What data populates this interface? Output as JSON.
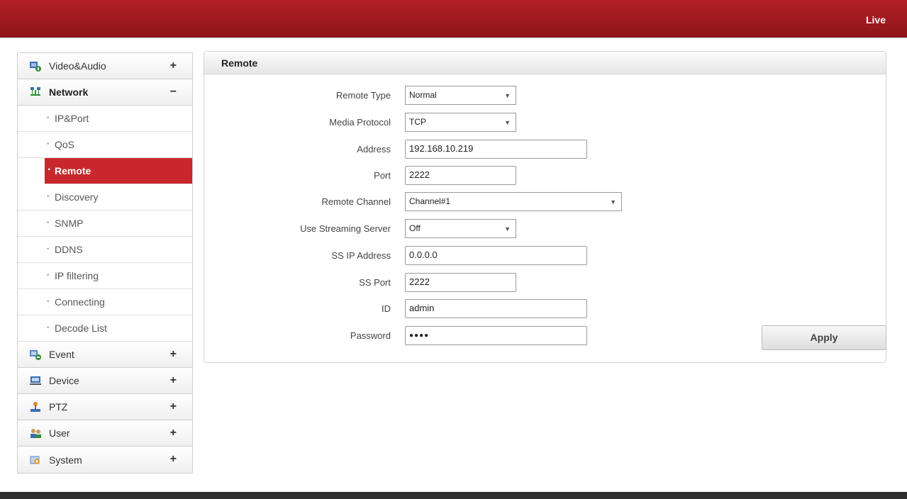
{
  "header": {
    "live_label": "Live"
  },
  "sidebar": {
    "video_audio": {
      "label": "Video&Audio",
      "toggle": "+"
    },
    "network": {
      "label": "Network",
      "toggle": "−",
      "items": [
        {
          "label": "IP&Port"
        },
        {
          "label": "QoS"
        },
        {
          "label": "Remote"
        },
        {
          "label": "Discovery"
        },
        {
          "label": "SNMP"
        },
        {
          "label": "DDNS"
        },
        {
          "label": "IP filtering"
        },
        {
          "label": "Connecting"
        },
        {
          "label": "Decode List"
        }
      ]
    },
    "event": {
      "label": "Event",
      "toggle": "+"
    },
    "device": {
      "label": "Device",
      "toggle": "+"
    },
    "ptz": {
      "label": "PTZ",
      "toggle": "+"
    },
    "user": {
      "label": "User",
      "toggle": "+"
    },
    "system": {
      "label": "System",
      "toggle": "+"
    }
  },
  "panel": {
    "title": "Remote",
    "fields": {
      "remote_type": {
        "label": "Remote Type",
        "value": "Normal"
      },
      "media_protocol": {
        "label": "Media Protocol",
        "value": "TCP"
      },
      "address": {
        "label": "Address",
        "value": "192.168.10.219"
      },
      "port": {
        "label": "Port",
        "value": "2222"
      },
      "remote_channel": {
        "label": "Remote Channel",
        "value": "Channel#1"
      },
      "use_streaming_server": {
        "label": "Use Streaming Server",
        "value": "Off"
      },
      "ss_ip_address": {
        "label": "SS IP Address",
        "value": "0.0.0.0"
      },
      "ss_port": {
        "label": "SS Port",
        "value": "2222"
      },
      "id": {
        "label": "ID",
        "value": "admin"
      },
      "password": {
        "label": "Password",
        "value": "●●●●"
      }
    },
    "apply_label": "Apply"
  },
  "colors": {
    "brand_red": "#a81c21",
    "active_red": "#c8272d"
  }
}
